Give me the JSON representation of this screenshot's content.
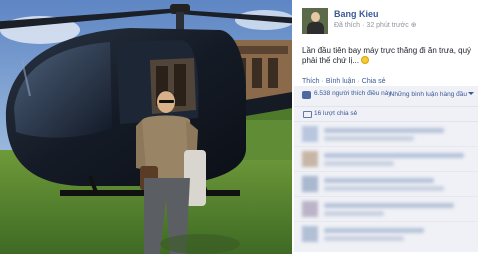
{
  "post": {
    "author": "Bang Kieu",
    "likes_label": "Đã thích",
    "time_label": "32 phút trước",
    "status_text": "Lần đầu tiên bay máy trực thăng đi ăn trưa, quý phải thế chứ lị...",
    "actions": [
      "Thích",
      "Bình luận",
      "Chia sẻ"
    ]
  },
  "ufi": {
    "like_count_text": "6.538 người thích điều này.",
    "top_comments_label": "Những bình luận hàng đầu",
    "share_count_text": "16 lượt chia sẻ"
  },
  "colors": {
    "link": "#3b5998",
    "ufi_bg": "#eff1f6",
    "text": "#1d2129",
    "meta": "#90949c"
  },
  "icons": [
    "globe-icon",
    "smiley-icon",
    "thumb-icon",
    "caret-icon",
    "share-icon"
  ]
}
